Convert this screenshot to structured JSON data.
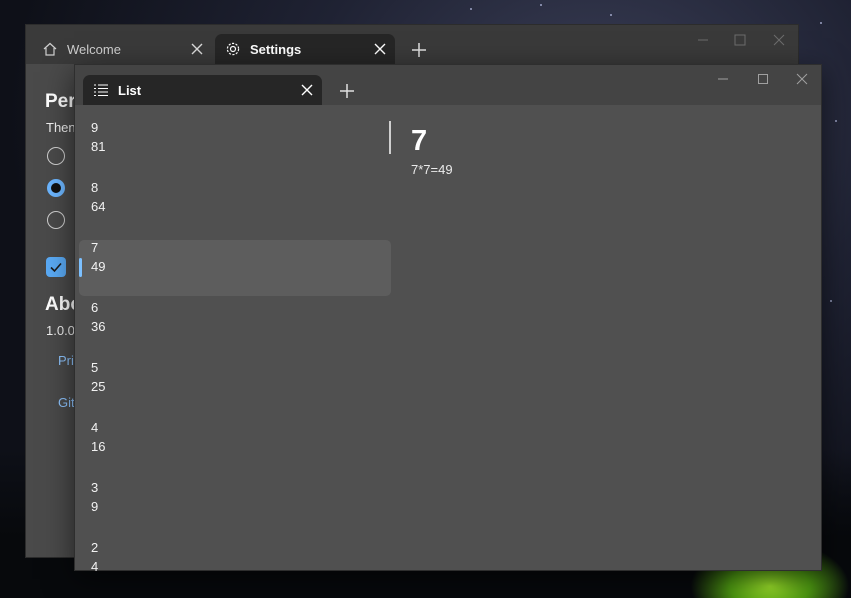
{
  "back_window": {
    "tabs": [
      {
        "label": "Welcome",
        "icon": "home-icon"
      },
      {
        "label": "Settings",
        "icon": "gear-icon"
      }
    ],
    "heading1": "Per",
    "theme_text": "Then",
    "heading2": "Abo",
    "version": "1.0.0",
    "link1": "Pri",
    "link2": "Git"
  },
  "front_window": {
    "tab": {
      "label": "List",
      "icon": "list-icon"
    },
    "items": [
      {
        "n": "9",
        "sq": "81"
      },
      {
        "n": "8",
        "sq": "64"
      },
      {
        "n": "7",
        "sq": "49",
        "selected": true
      },
      {
        "n": "6",
        "sq": "36"
      },
      {
        "n": "5",
        "sq": "25"
      },
      {
        "n": "4",
        "sq": "16"
      },
      {
        "n": "3",
        "sq": "9"
      },
      {
        "n": "2",
        "sq": "4"
      }
    ],
    "detail": {
      "title": "7",
      "subtitle": "7*7=49"
    }
  },
  "colors": {
    "accent": "#6cb6ff",
    "link": "#8ec5ff",
    "selected_bg": "#5d5d5d"
  }
}
